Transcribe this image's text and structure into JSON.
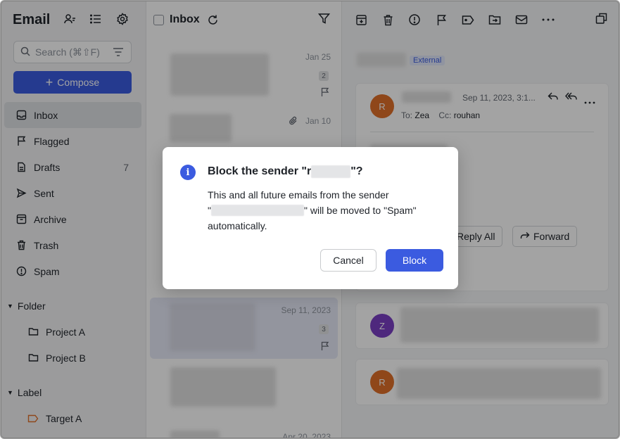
{
  "app": {
    "title": "Email"
  },
  "search": {
    "placeholder": "Search (⌘⇧F)"
  },
  "compose": {
    "label": "Compose"
  },
  "nav": [
    {
      "label": "Inbox",
      "icon": "inbox-icon",
      "active": true
    },
    {
      "label": "Flagged",
      "icon": "flag-icon"
    },
    {
      "label": "Drafts",
      "icon": "draft-icon",
      "count": "7"
    },
    {
      "label": "Sent",
      "icon": "send-icon"
    },
    {
      "label": "Archive",
      "icon": "archive-icon"
    },
    {
      "label": "Trash",
      "icon": "trash-icon"
    },
    {
      "label": "Spam",
      "icon": "spam-icon"
    }
  ],
  "folder": {
    "label": "Folder",
    "items": [
      "Project A",
      "Project B"
    ]
  },
  "label_section": {
    "label": "Label",
    "items": [
      "Target A"
    ]
  },
  "list": {
    "title": "Inbox",
    "mails": [
      {
        "date": "Jan 25",
        "count": "2"
      },
      {
        "date": "Jan 10",
        "attachment": true
      },
      {
        "date": "Sep 11, 2023",
        "count": "3"
      },
      {
        "date": "Apr 20, 2023"
      }
    ]
  },
  "reader": {
    "tag": "External",
    "message": {
      "date": "Sep 11, 2023, 3:1...",
      "to_label": "To:",
      "to": "Zea",
      "cc_label": "Cc:",
      "cc": "rouhan",
      "reply_all": "Reply All",
      "forward": "Forward"
    },
    "avatars": [
      "R",
      "Z",
      "R"
    ]
  },
  "dialog": {
    "title_prefix": "Block the sender \"",
    "title_visible_char": "r",
    "title_suffix": "\"?",
    "body_line1": "This and all future emails from the sender",
    "body_line2_prefix": "\"",
    "body_line2_suffix": "\" will be moved to \"Spam\"",
    "body_line3": "automatically.",
    "cancel": "Cancel",
    "confirm": "Block"
  },
  "colors": {
    "accent": "#3b5be0",
    "avatar_r": "#e0702a",
    "avatar_z": "#7b3fc4"
  }
}
